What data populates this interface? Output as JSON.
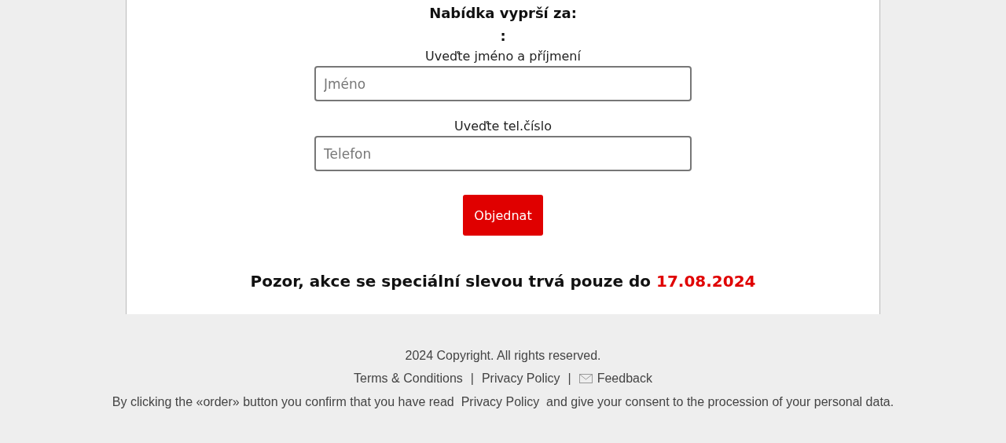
{
  "offer": {
    "title": "Nabídka vyprší za:",
    "countdown": ":"
  },
  "form": {
    "fields": [
      {
        "label": "Uveďte jméno a příjmení",
        "placeholder": "Jméno"
      },
      {
        "label": "Uveďte tel.číslo",
        "placeholder": "Telefon"
      }
    ],
    "submit": "Objednat"
  },
  "notice": {
    "text": "Pozor, akce se speciální slevou trvá pouze do",
    "date": "17.08.2024"
  },
  "footer": {
    "copyright": "2024 Copyright. All rights reserved.",
    "links": [
      {
        "label": "Terms & Conditions",
        "kind": "plain"
      },
      {
        "label": "Privacy Policy",
        "kind": "plain"
      },
      {
        "label": "Feedback",
        "kind": "feedback"
      }
    ],
    "separators": [
      "|",
      "|"
    ],
    "consent": {
      "before": "By clicking the «order» button you confirm that you have read",
      "link": "Privacy Policy",
      "after": "and give your consent to the procession of your personal data."
    }
  }
}
